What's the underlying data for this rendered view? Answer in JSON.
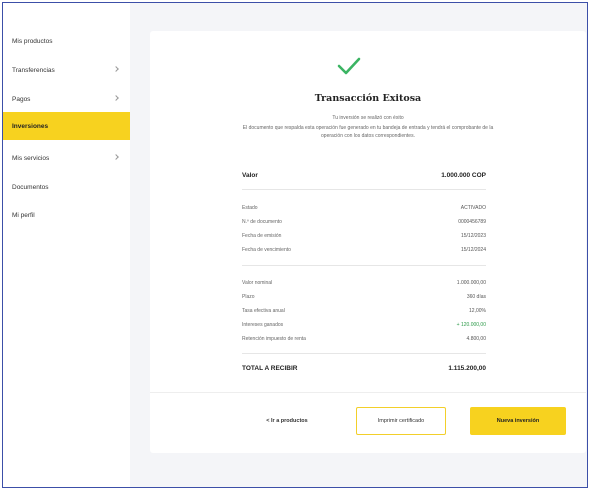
{
  "sidebar": {
    "items": [
      {
        "label": "Mis productos",
        "has_chevron": false,
        "active": false
      },
      {
        "label": "Transferencias",
        "has_chevron": true,
        "active": false
      },
      {
        "label": "Pagos",
        "has_chevron": true,
        "active": false
      },
      {
        "label": "Inversiones",
        "has_chevron": false,
        "active": true
      },
      {
        "label": "Mis servicios",
        "has_chevron": true,
        "active": false
      },
      {
        "label": "Documentos",
        "has_chevron": false,
        "active": false
      },
      {
        "label": "Mi perfil",
        "has_chevron": false,
        "active": false
      }
    ]
  },
  "receipt": {
    "title": "Transacción Exitosa",
    "subtitle": "Tu inversión se realizó con éxito",
    "description": "El documento que respalda esta operación fue generado en tu bandeja de entrada y tendrá el comprobante de la operación con los datos correspondientes.",
    "value_label": "Valor",
    "value_amount": "1.000.000 COP",
    "details": [
      {
        "label": "Estado",
        "value": "ACTIVADO"
      },
      {
        "label": "N.º de documento",
        "value": "0000456789"
      },
      {
        "label": "Fecha de emisión",
        "value": "15/12/2023"
      },
      {
        "label": "Fecha de vencimiento",
        "value": "15/12/2024"
      }
    ],
    "breakdown": [
      {
        "label": "Valor nominal",
        "value": "1.000.000,00",
        "highlight": false
      },
      {
        "label": "Plazo",
        "value": "360 días",
        "highlight": false
      },
      {
        "label": "Tasa efectiva anual",
        "value": "12,00%",
        "highlight": false
      },
      {
        "label": "Intereses ganados",
        "value": "+ 120.000,00",
        "highlight": true
      },
      {
        "label": "Retención impuesto de renta",
        "value": "4.800,00",
        "highlight": false
      }
    ],
    "total_label": "TOTAL A RECIBIR",
    "total_amount": "1.115.200,00",
    "colors": {
      "accent": "#f7d21f",
      "success": "#3bb463",
      "positive_text": "#2e9b4a"
    }
  },
  "buttons": {
    "back": "< Ir a productos",
    "certificate": "Imprimir certificado",
    "new_investment": "Nueva inversión"
  },
  "icons": {
    "success": "checkmark-icon"
  }
}
